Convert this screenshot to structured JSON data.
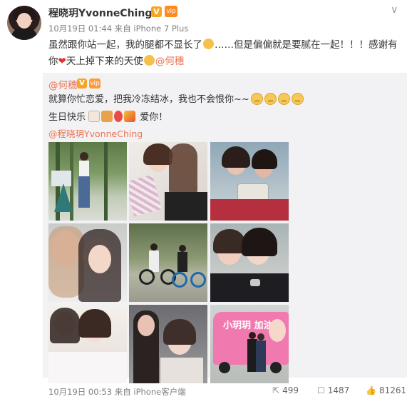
{
  "post": {
    "author": "程晓玥YvonneChing",
    "verified_mark": "V",
    "vip_mark": "vip",
    "timestamp": "10月19日 01:44",
    "source": "来自 iPhone 7 Plus",
    "text_line1": "虽然跟你站一起，我的腿都不显长了",
    "text_line1b": "……但是偏偏就是要腻在一起！！！感谢有",
    "text_line2_pre": "你",
    "text_line2_mid": "天上掉下来的天使",
    "mention": "@何穗",
    "more_chevron": "∨"
  },
  "repost": {
    "author": "@何穗",
    "verified_mark": "V",
    "vip_mark": "vip",
    "line1": "就算你忙恋爱，把我冷冻结冰，我也不会恨你~~",
    "line2_pre": "生日快乐",
    "line2_post": "爱你！",
    "mention": "@程晓玥YvonneChing",
    "photos": [
      {
        "name": "photo-bamboo-forest"
      },
      {
        "name": "photo-selfie-cash"
      },
      {
        "name": "photo-phone-selfie"
      },
      {
        "name": "photo-closeup-selfie"
      },
      {
        "name": "photo-bicycles"
      },
      {
        "name": "photo-hug-selfie"
      },
      {
        "name": "photo-bedroom"
      },
      {
        "name": "photo-makeup"
      },
      {
        "name": "photo-pink-van"
      }
    ],
    "van_text": "小玥玥 加油"
  },
  "footer": {
    "timestamp": "10月19日 00:53",
    "source": "来自 iPhone客户端",
    "share_count": "499",
    "comment_count": "1487",
    "like_count": "81261"
  },
  "colors": {
    "link": "#eb7350",
    "meta": "#808080",
    "repost_bg": "#f2f2f5"
  }
}
